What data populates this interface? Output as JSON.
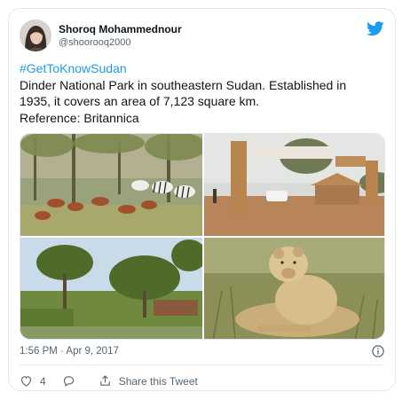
{
  "author": {
    "name": "Shoroq Mohammednour",
    "handle": "@shoorooq2000"
  },
  "tweet": {
    "hashtag": "#GetToKnowSudan",
    "text": "Dinder National Park in southeastern Sudan. Established in\n1935, it covers an area of 7,123 square km.\nReference: Britannica"
  },
  "media": [
    {
      "subject": "antelopes and zebras in grassland"
    },
    {
      "subject": "park entrance gate"
    },
    {
      "subject": "trees and river"
    },
    {
      "subject": "lioness in grass"
    }
  ],
  "timestamp": "1:56 PM · Apr 9, 2017",
  "actions": {
    "likes_count": "4",
    "share_label": "Share this Tweet"
  },
  "icons": {
    "brand": "twitter-bird-icon",
    "info": "info-icon",
    "like": "heart-icon",
    "reply": "reply-bubble-icon",
    "share": "share-icon"
  },
  "colors": {
    "accent": "#1d9bf0",
    "text": "#0f1419",
    "muted": "#536471",
    "border": "#dfe6ec"
  }
}
